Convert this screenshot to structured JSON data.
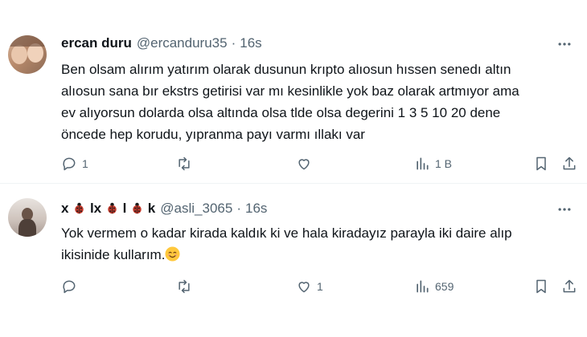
{
  "tweets": [
    {
      "name": "ercan duru",
      "handle": "@ercanduru35",
      "separator": "·",
      "time": "16s",
      "text": "Ben olsam alırım yatırım olarak dusunun krıpto alıosun hıssen senedı altın\nalıosun sana bır ekstrs getirisi var mı kesinlikle yok baz olarak artmıyor ama\nev alıyorsun dolarda olsa altında olsa tlde olsa degerini 1 3 5 10 20 dene\nöncede hep korudu, yıpranma payı varmı ıllakı var",
      "actions": {
        "replies": "1",
        "reposts": "",
        "likes": "",
        "views": "1 B"
      }
    },
    {
      "name_parts": [
        "x",
        "lx",
        "l",
        "k"
      ],
      "handle": "@asli_3065",
      "separator": "·",
      "time": "16s",
      "text": "Yok vermem o kadar kirada kaldık ki ve hala kiradayız parayla iki daire alıp\nikisinide kullarım.",
      "actions": {
        "replies": "",
        "reposts": "",
        "likes": "1",
        "views": "659"
      }
    }
  ],
  "icons": {
    "reply": "reply-icon",
    "repost": "repost-icon",
    "like": "like-icon",
    "views": "views-icon",
    "bookmark": "bookmark-icon",
    "share": "share-icon",
    "more": "more-icon",
    "name_emoji": "ladybug-icon",
    "text_emoji": "smiling-face-icon"
  },
  "colors": {
    "text": "#0f1419",
    "muted": "#536471",
    "divider": "#eff3f4",
    "ladybug": "#c0392b"
  }
}
